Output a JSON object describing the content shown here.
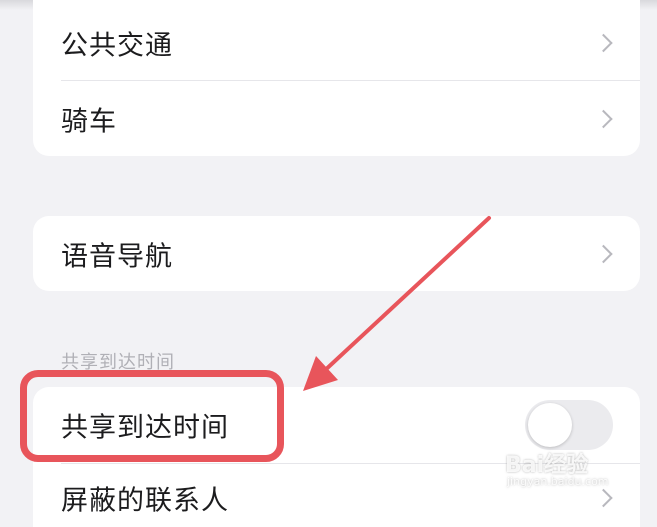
{
  "settings": {
    "transport_group": {
      "items": [
        {
          "label": "公共交通"
        },
        {
          "label": "骑车"
        }
      ]
    },
    "voice_group": {
      "items": [
        {
          "label": "语音导航"
        }
      ]
    },
    "share_section": {
      "header": "共享到达时间",
      "items": [
        {
          "label": "共享到达时间",
          "toggle_on": false
        },
        {
          "label": "屏蔽的联系人"
        }
      ]
    }
  },
  "annotation": {
    "color": "#e8555b"
  },
  "watermark": {
    "brand": "Bai经验",
    "url": "jingyan.baidu.com"
  }
}
